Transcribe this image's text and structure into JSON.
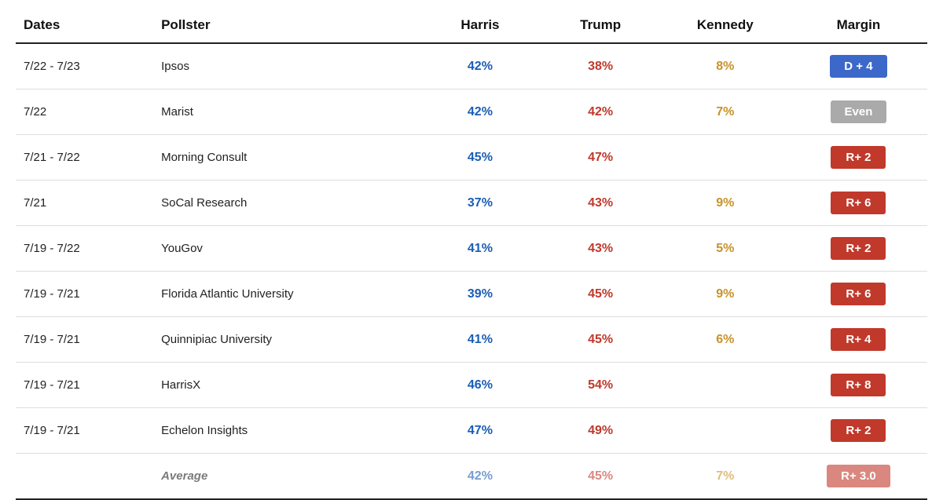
{
  "table": {
    "headers": {
      "dates": "Dates",
      "pollster": "Pollster",
      "harris": "Harris",
      "trump": "Trump",
      "kennedy": "Kennedy",
      "margin": "Margin"
    },
    "rows": [
      {
        "dates": "7/22 - 7/23",
        "pollster": "Ipsos",
        "harris": "42%",
        "trump": "38%",
        "kennedy": "8%",
        "margin": "D + 4",
        "marginType": "d"
      },
      {
        "dates": "7/22",
        "pollster": "Marist",
        "harris": "42%",
        "trump": "42%",
        "kennedy": "7%",
        "margin": "Even",
        "marginType": "even"
      },
      {
        "dates": "7/21 - 7/22",
        "pollster": "Morning Consult",
        "harris": "45%",
        "trump": "47%",
        "kennedy": "",
        "margin": "R+ 2",
        "marginType": "r"
      },
      {
        "dates": "7/21",
        "pollster": "SoCal Research",
        "harris": "37%",
        "trump": "43%",
        "kennedy": "9%",
        "margin": "R+ 6",
        "marginType": "r"
      },
      {
        "dates": "7/19 - 7/22",
        "pollster": "YouGov",
        "harris": "41%",
        "trump": "43%",
        "kennedy": "5%",
        "margin": "R+ 2",
        "marginType": "r"
      },
      {
        "dates": "7/19 - 7/21",
        "pollster": "Florida Atlantic University",
        "harris": "39%",
        "trump": "45%",
        "kennedy": "9%",
        "margin": "R+ 6",
        "marginType": "r"
      },
      {
        "dates": "7/19 - 7/21",
        "pollster": "Quinnipiac University",
        "harris": "41%",
        "trump": "45%",
        "kennedy": "6%",
        "margin": "R+ 4",
        "marginType": "r"
      },
      {
        "dates": "7/19 - 7/21",
        "pollster": "HarrisX",
        "harris": "46%",
        "trump": "54%",
        "kennedy": "",
        "margin": "R+ 8",
        "marginType": "r"
      },
      {
        "dates": "7/19 - 7/21",
        "pollster": "Echelon Insights",
        "harris": "47%",
        "trump": "49%",
        "kennedy": "",
        "margin": "R+ 2",
        "marginType": "r"
      },
      {
        "dates": "",
        "pollster": "Average",
        "harris": "42%",
        "trump": "45%",
        "kennedy": "7%",
        "margin": "R+ 3.0",
        "marginType": "r",
        "isAverage": true
      }
    ]
  }
}
